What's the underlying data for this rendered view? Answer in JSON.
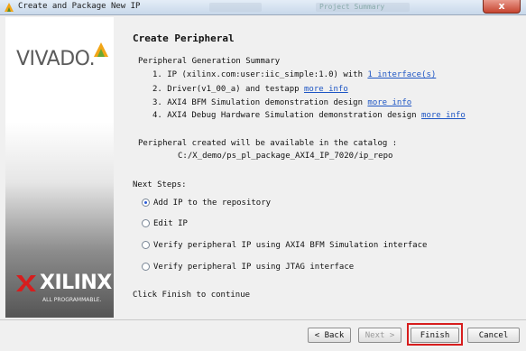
{
  "window": {
    "title": "Create and Package New IP",
    "ghost_tabs": [
      "Project Summary"
    ],
    "close_label": "x"
  },
  "sidebar": {
    "brand_top": "VIVADO.",
    "brand_bottom": "XILINX",
    "brand_tagline": "ALL PROGRAMMABLE."
  },
  "page": {
    "title": "Create Peripheral",
    "summary_header": "Peripheral Generation Summary",
    "summary_items": [
      {
        "text": "1. IP (xilinx.com:user:iic_simple:1.0) with",
        "link": "1 interface(s)"
      },
      {
        "text": "2. Driver(v1_00_a) and testapp",
        "link": "more info"
      },
      {
        "text": "3. AXI4 BFM Simulation demonstration design",
        "link": "more info"
      },
      {
        "text": "4. AXI4 Debug Hardware Simulation demonstration design",
        "link": "more info"
      }
    ],
    "catalog_text": "Peripheral created will be available in the catalog :",
    "catalog_path": "C:/X_demo/ps_pl_package_AXI4_IP_7020/ip_repo",
    "next_steps_label": "Next Steps:",
    "options": [
      {
        "label": "Add IP to the repository",
        "selected": true
      },
      {
        "label": "Edit IP",
        "selected": false
      },
      {
        "label": "Verify peripheral IP using AXI4 BFM Simulation interface",
        "selected": false
      },
      {
        "label": "Verify peripheral IP using JTAG interface",
        "selected": false
      }
    ],
    "footer_hint": "Click Finish to continue"
  },
  "buttons": {
    "back": "< Back",
    "next": "Next >",
    "finish": "Finish",
    "cancel": "Cancel"
  },
  "colors": {
    "link": "#1d55c4",
    "highlight": "#d71d1d",
    "radio_selected": "#2a5bd7"
  }
}
